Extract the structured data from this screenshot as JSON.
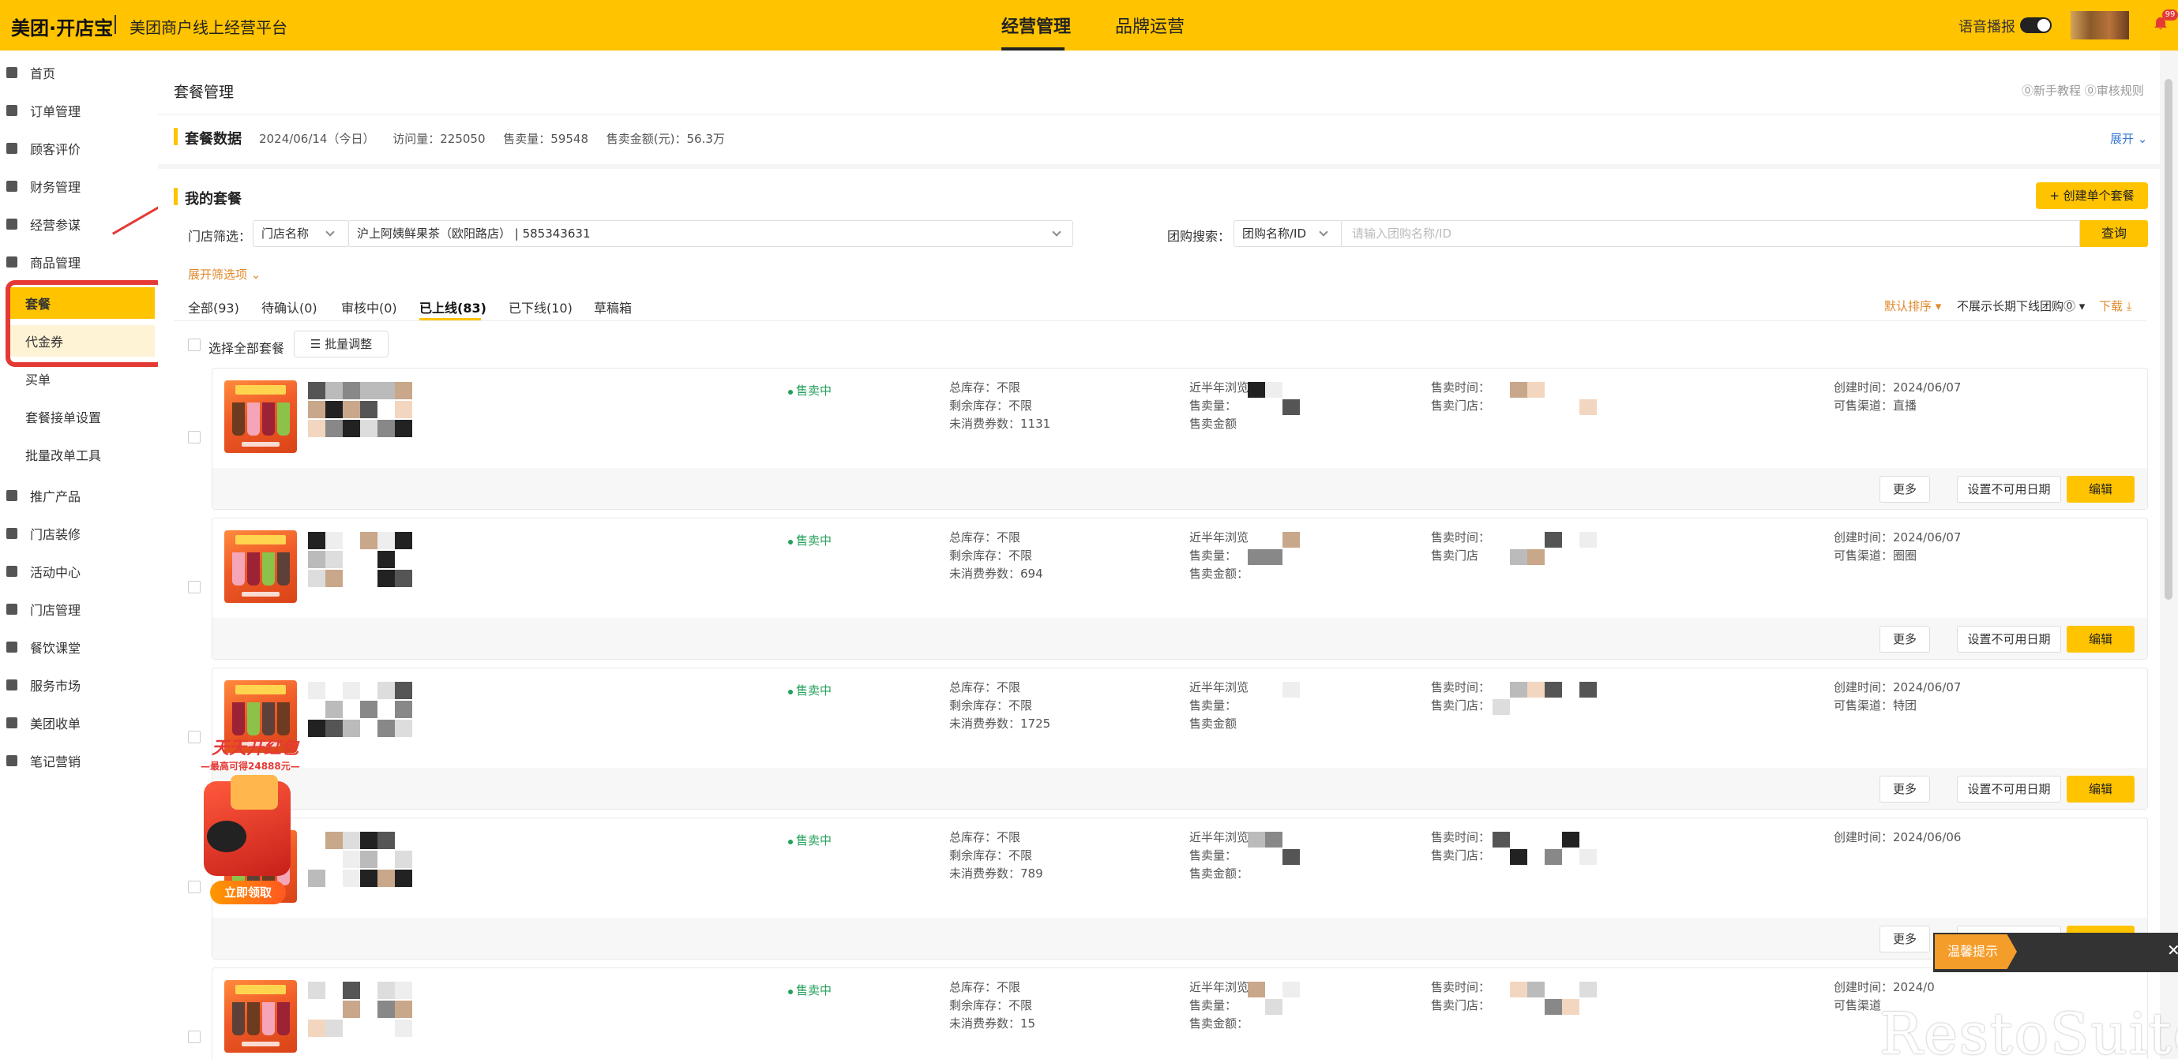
{
  "topbar": {
    "brand": "美团·开店宝",
    "platform": "美团商户线上经营平台",
    "tabs": [
      "经营管理",
      "品牌运营"
    ],
    "voice_label": "语音播报",
    "badge": "99"
  },
  "sidebar": {
    "items": [
      "首页",
      "订单管理",
      "顾客评价",
      "财务管理",
      "经营参谋",
      "商品管理"
    ],
    "sub_items": [
      "套餐",
      "代金券",
      "买单",
      "套餐接单设置",
      "批量改单工具"
    ],
    "items_after": [
      "推广产品",
      "门店装修",
      "活动中心",
      "门店管理",
      "餐饮课堂",
      "服务市场",
      "美团收单",
      "笔记营销"
    ]
  },
  "header": {
    "title": "套餐管理",
    "help_links": "⓪新手教程  ⓪审核规则"
  },
  "stats": {
    "title": "套餐数据",
    "date": "2024/06/14（今日）",
    "visits": "访问量：225050",
    "sales": "售卖量：59548",
    "amount": "售卖金额(元)：56.3万",
    "expand": "展开 ⌄"
  },
  "packages": {
    "title": "我的套餐",
    "create_btn": "+ 创建单个套餐",
    "store_filter_label": "门店筛选：",
    "store_type": "门店名称",
    "store_value": "沪上阿姨鲜果茶（欧阳路店）  |  585343631",
    "group_search_label": "团购搜索：",
    "group_type": "团购名称/ID",
    "search_placeholder": "请输入团购名称/ID",
    "query_btn": "查询",
    "more_filters": "展开筛选项 ⌄",
    "tabs": [
      "全部(93)",
      "待确认(0)",
      "审核中(0)",
      "已上线(83)",
      "已下线(10)",
      "草稿箱"
    ],
    "sort": "默认排序 ▾",
    "hide_offline": "不展示长期下线团购⓪ ▾",
    "download": "下载 ⤓",
    "select_all": "选择全部套餐",
    "batch_btn": "☰ 批量调整"
  },
  "cards": [
    {
      "status": "售卖中",
      "total_stock": "总库存：不限",
      "remain_stock": "剩余库存：不限",
      "unused": "未消费券数：1131",
      "col2": [
        "近半年浏览",
        "售卖量：",
        "售卖金额"
      ],
      "col3": [
        "售卖时间：",
        "售卖门店："
      ],
      "created": "创建时间：2024/06/07",
      "channel": "可售渠道：直播"
    },
    {
      "status": "售卖中",
      "total_stock": "总库存：不限",
      "remain_stock": "剩余库存：不限",
      "unused": "未消费券数：694",
      "col2": [
        "近半年浏览",
        "售卖量：",
        "售卖金额："
      ],
      "col3": [
        "售卖时间：",
        "售卖门店"
      ],
      "created": "创建时间：2024/06/07",
      "channel": "可售渠道：圈圈"
    },
    {
      "status": "售卖中",
      "total_stock": "总库存：不限",
      "remain_stock": "剩余库存：不限",
      "unused": "未消费券数：1725",
      "col2": [
        "近半年浏览",
        "售卖量：",
        "售卖金额"
      ],
      "col3": [
        "售卖时间：",
        "售卖门店："
      ],
      "created": "创建时间：2024/06/07",
      "channel": "可售渠道：特团"
    },
    {
      "status": "售卖中",
      "total_stock": "总库存：不限",
      "remain_stock": "剩余库存：不限",
      "unused": "未消费券数：789",
      "col2": [
        "近半年浏览",
        "售卖量：",
        "售卖金额："
      ],
      "col3": [
        "售卖时间：",
        "售卖门店："
      ],
      "created": "创建时间：2024/06/06",
      "channel": ""
    },
    {
      "status": "售卖中",
      "total_stock": "总库存：不限",
      "remain_stock": "剩余库存：不限",
      "unused": "未消费券数：15",
      "col2": [
        "近半年浏览",
        "售卖量：",
        "售卖金额："
      ],
      "col3": [
        "售卖时间：",
        "售卖门店："
      ],
      "created": "创建时间：2024/0",
      "channel": "可售渠道"
    }
  ],
  "card_buttons": {
    "more": "更多",
    "date": "设置不可用日期",
    "edit": "编辑"
  },
  "promo": {
    "title": "天天开红包",
    "sub": "—最高可得24888元—",
    "btn": "立即领取"
  },
  "toast": {
    "tag": "温馨提示",
    "close": "✕"
  },
  "watermark": "RestoSuite"
}
